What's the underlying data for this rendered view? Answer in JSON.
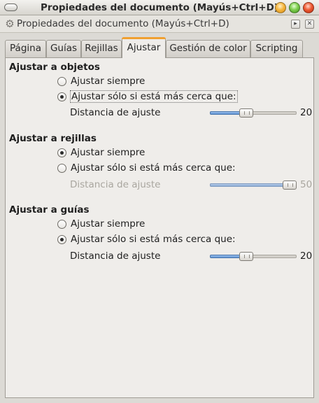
{
  "window": {
    "title": "Propiedades del documento (Mayús+Ctrl+D)"
  },
  "dock": {
    "title": "Propiedades del documento (Mayús+Ctrl+D)",
    "icon": "gear-icon"
  },
  "tabs": [
    {
      "label": "Página",
      "active": false
    },
    {
      "label": "Guías",
      "active": false
    },
    {
      "label": "Rejillas",
      "active": false
    },
    {
      "label": "Ajustar",
      "active": true
    },
    {
      "label": "Gestión de color",
      "active": false
    },
    {
      "label": "Scripting",
      "active": false
    }
  ],
  "sections": [
    {
      "title": "Ajustar a objetos",
      "option_always": "Ajustar siempre",
      "option_near": "Ajustar sólo si está más cerca que:",
      "selected": "near",
      "distance_label": "Distancia de ajuste",
      "distance_value": "20",
      "distance_fraction": 0.4,
      "enabled": true
    },
    {
      "title": "Ajustar a rejillas",
      "option_always": "Ajustar siempre",
      "option_near": "Ajustar sólo si está más cerca que:",
      "selected": "always",
      "distance_label": "Distancia de ajuste",
      "distance_value": "50",
      "distance_fraction": 1.0,
      "enabled": false
    },
    {
      "title": "Ajustar a guías",
      "option_always": "Ajustar siempre",
      "option_near": "Ajustar sólo si está más cerca que:",
      "selected": "near",
      "distance_label": "Distancia de ajuste",
      "distance_value": "20",
      "distance_fraction": 0.4,
      "enabled": true
    }
  ],
  "colors": {
    "active_tab_accent": "#f0a030",
    "slider_fill": "#5c8fd0"
  }
}
